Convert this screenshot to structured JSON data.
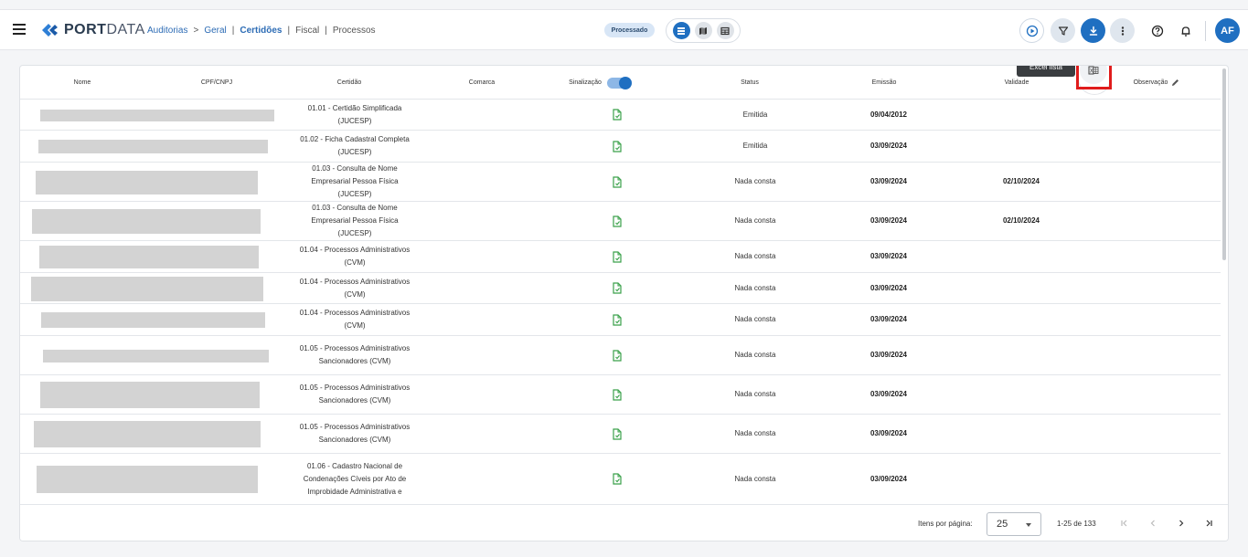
{
  "header": {
    "logo": {
      "bold": "PORT",
      "light": "DATA"
    },
    "breadcrumb": {
      "auditorias": "Auditorias",
      "arrow": ">",
      "geral": "Geral",
      "sep1": "|",
      "certidoes": "Certidões",
      "sep2": "|",
      "fiscal": "Fiscal",
      "sep3": "|",
      "processos": "Processos"
    },
    "status_chip": "Processado",
    "avatar": "AF"
  },
  "table": {
    "columns": {
      "nome": "Nome",
      "cpf": "CPF/CNPJ",
      "certidao": "Certidão",
      "comarca": "Comarca",
      "sinalizacao": "Sinalização",
      "status": "Status",
      "emissao": "Emissão",
      "validade": "Validade",
      "observacao": "Observação"
    },
    "tooltip": "Excel lista",
    "rows": [
      {
        "certidao": "01.01 - Certidão Simplificada (JUCESP)",
        "status": "Emitida",
        "emissao": "09/04/2012",
        "validade": ""
      },
      {
        "certidao": "01.02 - Ficha Cadastral Completa (JUCESP)",
        "status": "Emitida",
        "emissao": "03/09/2024",
        "validade": ""
      },
      {
        "certidao": "01.03 - Consulta de Nome Empresarial Pessoa Física (JUCESP)",
        "status": "Nada consta",
        "emissao": "03/09/2024",
        "validade": "02/10/2024"
      },
      {
        "certidao": "01.03 - Consulta de Nome Empresarial Pessoa Física (JUCESP)",
        "status": "Nada consta",
        "emissao": "03/09/2024",
        "validade": "02/10/2024"
      },
      {
        "certidao": "01.04 - Processos Administrativos (CVM)",
        "status": "Nada consta",
        "emissao": "03/09/2024",
        "validade": ""
      },
      {
        "certidao": "01.04 - Processos Administrativos (CVM)",
        "status": "Nada consta",
        "emissao": "03/09/2024",
        "validade": ""
      },
      {
        "certidao": "01.04 - Processos Administrativos (CVM)",
        "status": "Nada consta",
        "emissao": "03/09/2024",
        "validade": ""
      },
      {
        "certidao": "01.05 - Processos Administrativos Sancionadores (CVM)",
        "status": "Nada consta",
        "emissao": "03/09/2024",
        "validade": ""
      },
      {
        "certidao": "01.05 - Processos Administrativos Sancionadores (CVM)",
        "status": "Nada consta",
        "emissao": "03/09/2024",
        "validade": ""
      },
      {
        "certidao": "01.05 - Processos Administrativos Sancionadores (CVM)",
        "status": "Nada consta",
        "emissao": "03/09/2024",
        "validade": ""
      },
      {
        "certidao": "01.06 - Cadastro Nacional de Condenações Cíveis por Ato de Improbidade Administrativa e",
        "status": "Nada consta",
        "emissao": "03/09/2024",
        "validade": ""
      }
    ]
  },
  "pagination": {
    "label": "Itens por página:",
    "page_size": "25",
    "range": "1-25 de 133"
  },
  "colors": {
    "primary": "#1f6fc1",
    "status_chip_bg": "#d8e6f6",
    "doc_icon": "#3aa14a",
    "highlight": "#e01c1c"
  }
}
